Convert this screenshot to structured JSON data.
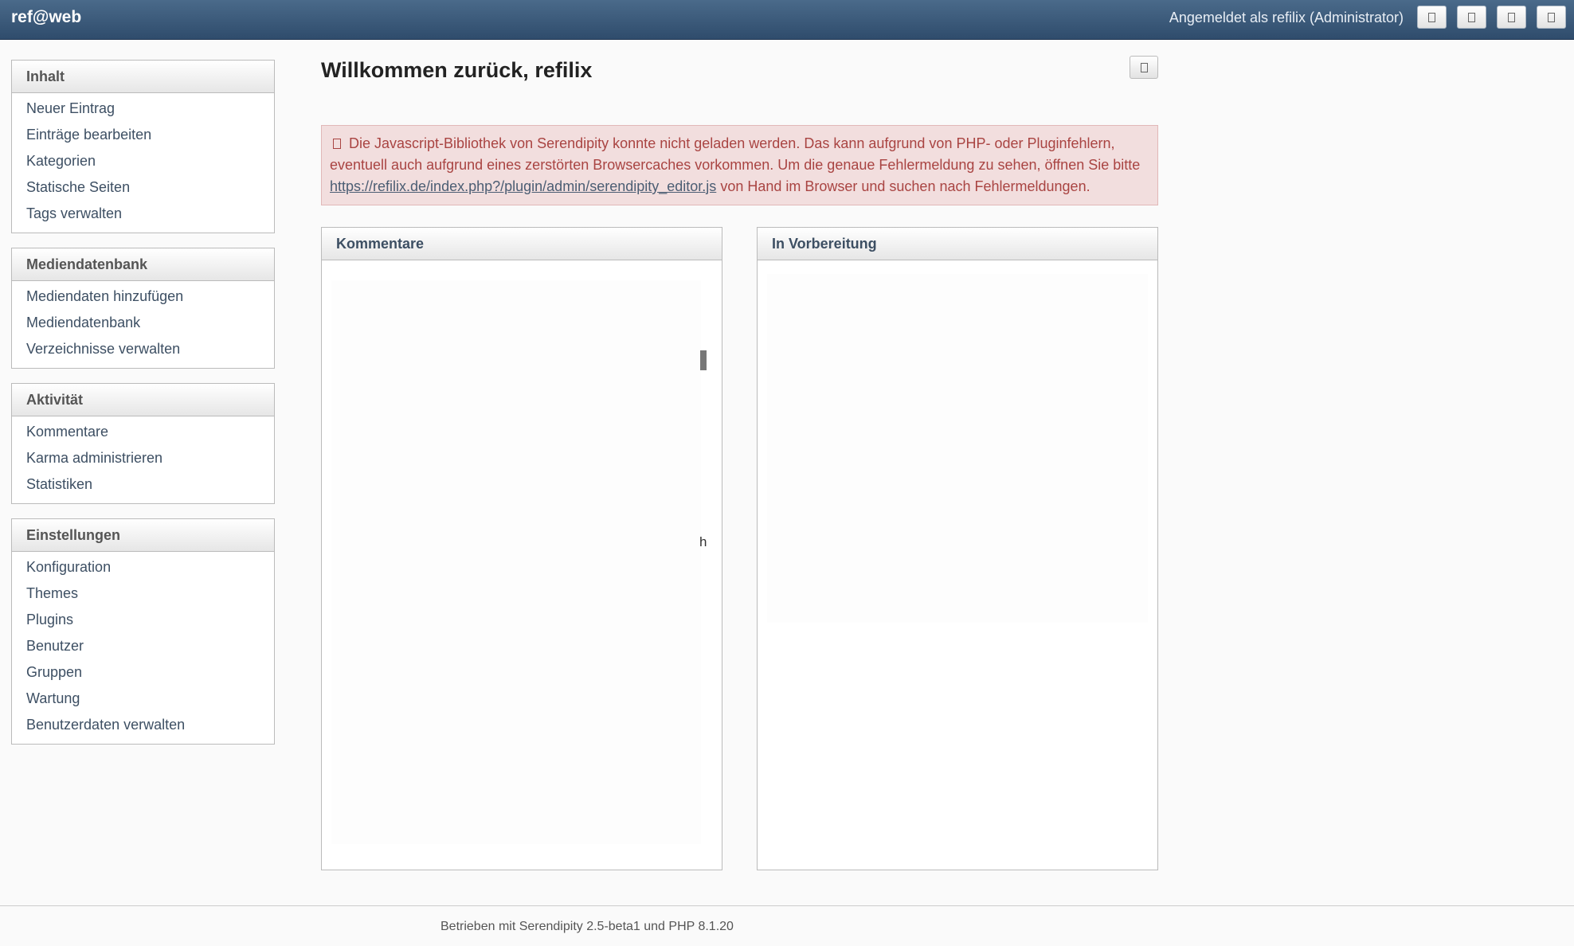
{
  "header": {
    "brand": "ref@web",
    "logged_in": "Angemeldet als refilix (Administrator)",
    "buttons": [
      {
        "icon": "dashboard-icon"
      },
      {
        "icon": "blog-icon"
      },
      {
        "icon": "user-icon"
      },
      {
        "icon": "logout-icon"
      }
    ]
  },
  "sidebar": {
    "sections": [
      {
        "title": "Inhalt",
        "items": [
          "Neuer Eintrag",
          "Einträge bearbeiten",
          "Kategorien",
          "Statische Seiten",
          "Tags verwalten"
        ]
      },
      {
        "title": "Mediendatenbank",
        "items": [
          "Mediendaten hinzufügen",
          "Mediendatenbank",
          "Verzeichnisse verwalten"
        ]
      },
      {
        "title": "Aktivität",
        "items": [
          "Kommentare",
          "Karma administrieren",
          "Statistiken"
        ]
      },
      {
        "title": "Einstellungen",
        "items": [
          "Konfiguration",
          "Themes",
          "Plugins",
          "Benutzer",
          "Gruppen",
          "Wartung",
          "Benutzerdaten verwalten"
        ]
      }
    ]
  },
  "main": {
    "title": "Willkommen zurück, refilix",
    "alert": {
      "text_before": "Die Javascript-Bibliothek von Serendipity konnte nicht geladen werden. Das kann aufgrund von PHP- oder Pluginfehlern, eventuell auch aufgrund eines zerstörten Browsercaches vorkommen. Um die genaue Fehlermeldung zu sehen, öffnen Sie bitte",
      "link": "https://refilix.de/index.php?/plugin/admin/serendipity_editor.js",
      "text_after": "von Hand im Browser und suchen nach Fehlermeldungen.",
      "color": "#a94442"
    },
    "widgets": {
      "comments": {
        "title": "Kommentare",
        "fragment": "h"
      },
      "drafts": {
        "title": "In Vorbereitung"
      }
    }
  },
  "footer": {
    "text": "Betrieben mit Serendipity 2.5-beta1 und PHP 8.1.20"
  }
}
